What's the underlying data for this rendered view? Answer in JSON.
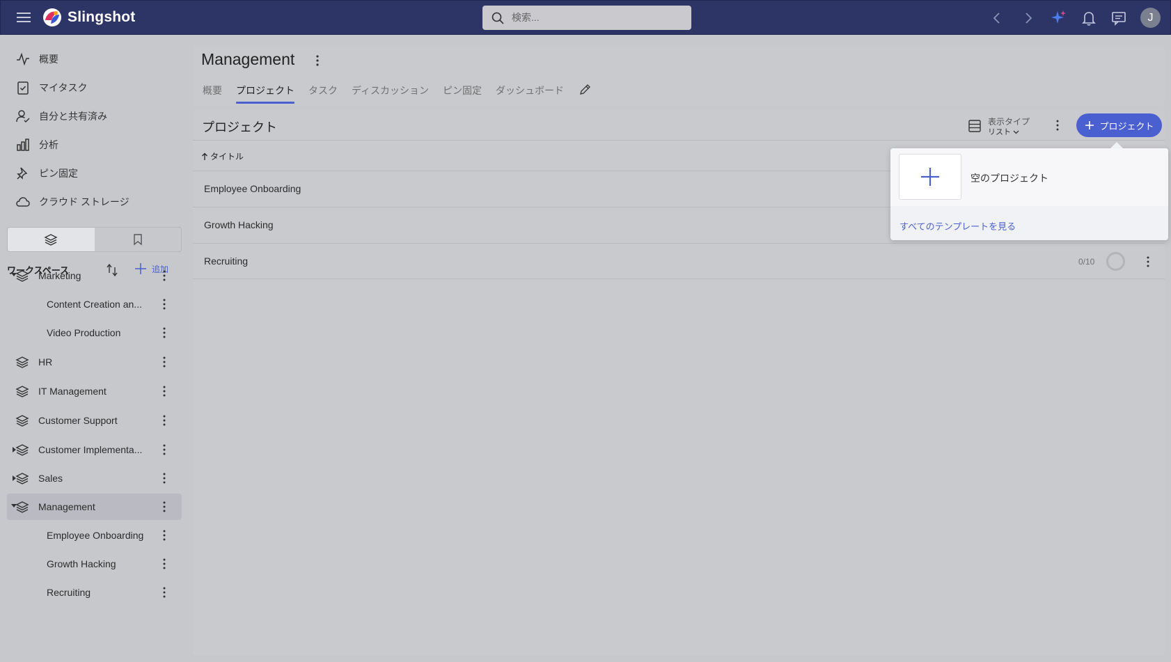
{
  "app": {
    "brand": "Slingshot",
    "search_placeholder": "検索...",
    "user_initial": "J",
    "accent_color": "#4a5fd0",
    "topbar_color": "#2c3566"
  },
  "nav": {
    "items": [
      {
        "label": "概要",
        "icon": "activity-icon"
      },
      {
        "label": "マイタスク",
        "icon": "clipboard-check-icon"
      },
      {
        "label": "自分と共有済み",
        "icon": "user-check-icon"
      },
      {
        "label": "分析",
        "icon": "bar-chart-icon"
      },
      {
        "label": "ピン固定",
        "icon": "pin-icon"
      },
      {
        "label": "クラウド ストレージ",
        "icon": "cloud-icon"
      }
    ]
  },
  "workspaces": {
    "title": "ワークスペース",
    "add_label": "追加",
    "tree": [
      {
        "label": "Marketing",
        "level": 0,
        "caret": "down"
      },
      {
        "label": "Content Creation an...",
        "level": 1
      },
      {
        "label": "Video Production",
        "level": 1
      },
      {
        "label": "HR",
        "level": 0
      },
      {
        "label": "IT Management",
        "level": 0
      },
      {
        "label": "Customer Support",
        "level": 0
      },
      {
        "label": "Customer Implementa...",
        "level": 0,
        "caret": "right"
      },
      {
        "label": "Sales",
        "level": 0,
        "caret": "right"
      },
      {
        "label": "Management",
        "level": 0,
        "caret": "down",
        "selected": true
      },
      {
        "label": "Employee Onboarding",
        "level": 1
      },
      {
        "label": "Growth Hacking",
        "level": 1
      },
      {
        "label": "Recruiting",
        "level": 1
      }
    ]
  },
  "header": {
    "title": "Management",
    "tabs": [
      {
        "label": "概要",
        "active": false
      },
      {
        "label": "プロジェクト",
        "active": true
      },
      {
        "label": "タスク",
        "active": false
      },
      {
        "label": "ディスカッション",
        "active": false
      },
      {
        "label": "ピン固定",
        "active": false
      },
      {
        "label": "ダッシュボード",
        "active": false
      }
    ]
  },
  "projects": {
    "title": "プロジェクト",
    "view_type_label": "表示タイプ",
    "view_type_value": "リスト",
    "add_button_label": "プロジェクト",
    "column_title": "タイトル",
    "rows": [
      {
        "name": "Employee Onboarding",
        "count": ""
      },
      {
        "name": "Growth Hacking",
        "count": ""
      },
      {
        "name": "Recruiting",
        "count": "0/10"
      }
    ]
  },
  "dropdown": {
    "blank_project_label": "空のプロジェクト",
    "all_templates_link": "すべてのテンプレートを見る"
  }
}
